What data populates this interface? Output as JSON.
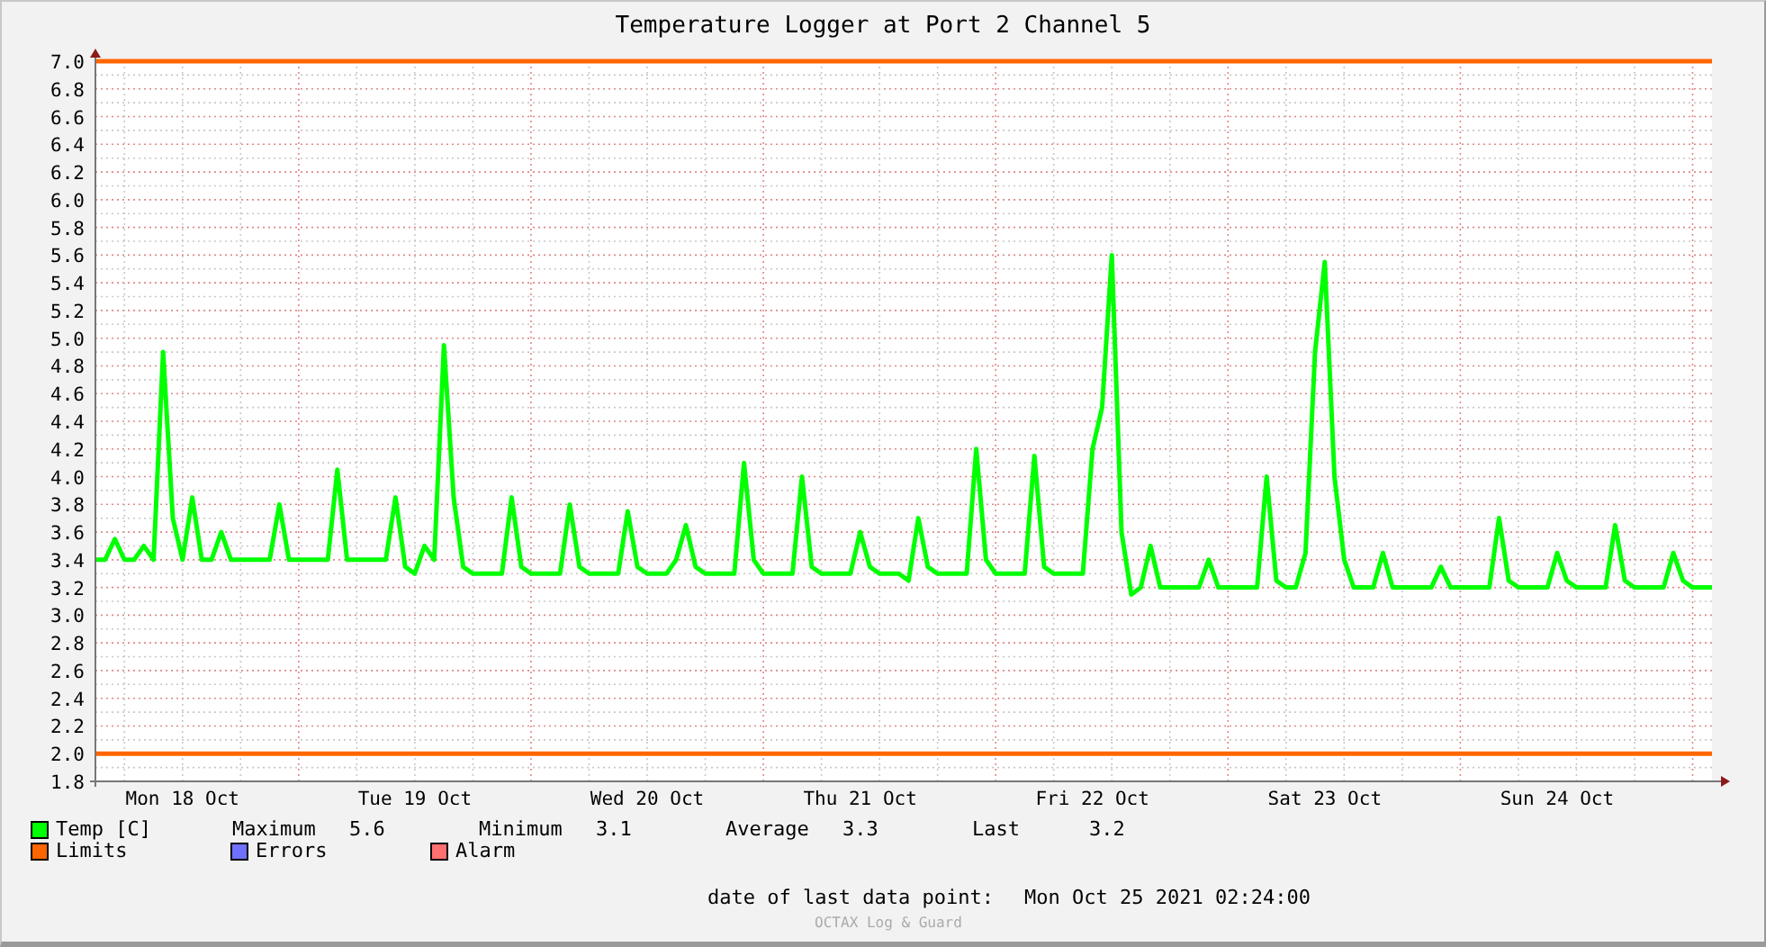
{
  "title": "Temperature Logger at Port 2 Channel 5",
  "chart_data": {
    "type": "line",
    "categories": [
      null,
      null,
      null,
      null,
      null,
      null,
      null,
      null,
      null,
      "Mon 18 Oct",
      null,
      null,
      null,
      null,
      null,
      null,
      null,
      null,
      null,
      null,
      null,
      null,
      null,
      null,
      null,
      null,
      null,
      null,
      null,
      null,
      null,
      null,
      null,
      "Tue 19 Oct",
      null,
      null,
      null,
      null,
      null,
      null,
      null,
      null,
      null,
      null,
      null,
      null,
      null,
      null,
      null,
      null,
      null,
      null,
      null,
      null,
      null,
      null,
      null,
      "Wed 20 Oct",
      null,
      null,
      null,
      null,
      null,
      null,
      null,
      null,
      null,
      null,
      null,
      null,
      null,
      null,
      null,
      null,
      null,
      null,
      null,
      null,
      null,
      "Thu 21 Oct",
      null,
      null,
      null,
      null,
      null,
      null,
      null,
      null,
      null,
      null,
      null,
      null,
      null,
      null,
      null,
      null,
      null,
      null,
      null,
      null,
      null,
      null,
      null,
      "Fri 22 Oct",
      null,
      null,
      null,
      null,
      null,
      null,
      null,
      null,
      null,
      null,
      null,
      null,
      null,
      null,
      null,
      null,
      null,
      null,
      null,
      null,
      null,
      null,
      null,
      "Sat 23 Oct",
      null,
      null,
      null,
      null,
      null,
      null,
      null,
      null,
      null,
      null,
      null,
      null,
      null,
      null,
      null,
      null,
      null,
      null,
      null,
      null,
      null,
      null,
      null,
      "Sun 24 Oct",
      null,
      null,
      null,
      null,
      null,
      null,
      null,
      null,
      null,
      null,
      null,
      null,
      null,
      null,
      null,
      null
    ],
    "series": [
      {
        "name": "Temp [C]",
        "color": "#00ff00",
        "values": [
          3.4,
          3.4,
          3.55,
          3.4,
          3.4,
          3.5,
          3.4,
          4.9,
          3.7,
          3.4,
          3.85,
          3.4,
          3.4,
          3.6,
          3.4,
          3.4,
          3.4,
          3.4,
          3.4,
          3.8,
          3.4,
          3.4,
          3.4,
          3.4,
          3.4,
          4.05,
          3.4,
          3.4,
          3.4,
          3.4,
          3.4,
          3.85,
          3.35,
          3.3,
          3.5,
          3.4,
          4.95,
          3.85,
          3.35,
          3.3,
          3.3,
          3.3,
          3.3,
          3.85,
          3.35,
          3.3,
          3.3,
          3.3,
          3.3,
          3.8,
          3.35,
          3.3,
          3.3,
          3.3,
          3.3,
          3.75,
          3.35,
          3.3,
          3.3,
          3.3,
          3.4,
          3.65,
          3.35,
          3.3,
          3.3,
          3.3,
          3.3,
          4.1,
          3.4,
          3.3,
          3.3,
          3.3,
          3.3,
          4.0,
          3.35,
          3.3,
          3.3,
          3.3,
          3.3,
          3.6,
          3.35,
          3.3,
          3.3,
          3.3,
          3.25,
          3.7,
          3.35,
          3.3,
          3.3,
          3.3,
          3.3,
          4.2,
          3.4,
          3.3,
          3.3,
          3.3,
          3.3,
          4.15,
          3.35,
          3.3,
          3.3,
          3.3,
          3.3,
          4.2,
          4.5,
          5.6,
          3.6,
          3.15,
          3.2,
          3.5,
          3.2,
          3.2,
          3.2,
          3.2,
          3.2,
          3.4,
          3.2,
          3.2,
          3.2,
          3.2,
          3.2,
          4.0,
          3.25,
          3.2,
          3.2,
          3.45,
          4.9,
          5.55,
          4.0,
          3.4,
          3.2,
          3.2,
          3.2,
          3.45,
          3.2,
          3.2,
          3.2,
          3.2,
          3.2,
          3.35,
          3.2,
          3.2,
          3.2,
          3.2,
          3.2,
          3.7,
          3.25,
          3.2,
          3.2,
          3.2,
          3.2,
          3.45,
          3.25,
          3.2,
          3.2,
          3.2,
          3.2,
          3.65,
          3.25,
          3.2,
          3.2,
          3.2,
          3.2,
          3.45,
          3.25,
          3.2,
          3.2,
          3.2
        ]
      }
    ],
    "ylim": [
      1.8,
      7.0
    ],
    "yticks": [
      {
        "value": 7.0,
        "label": "7.0"
      },
      {
        "value": 6.8,
        "label": "6.8"
      },
      {
        "value": 6.6,
        "label": "6.6"
      },
      {
        "value": 6.4,
        "label": "6.4"
      },
      {
        "value": 6.2,
        "label": "6.2"
      },
      {
        "value": 6.0,
        "label": "6.0"
      },
      {
        "value": 5.8,
        "label": "5.8"
      },
      {
        "value": 5.6,
        "label": "5.6"
      },
      {
        "value": 5.4,
        "label": "5.4"
      },
      {
        "value": 5.2,
        "label": "5.2"
      },
      {
        "value": 5.0,
        "label": "5.0"
      },
      {
        "value": 4.8,
        "label": "4.8"
      },
      {
        "value": 4.6,
        "label": "4.6"
      },
      {
        "value": 4.4,
        "label": "4.4"
      },
      {
        "value": 4.2,
        "label": "4.2"
      },
      {
        "value": 4.0,
        "label": "4.0"
      },
      {
        "value": 3.8,
        "label": "3.8"
      },
      {
        "value": 3.6,
        "label": "3.6"
      },
      {
        "value": 3.4,
        "label": "3.4"
      },
      {
        "value": 3.2,
        "label": "3.2"
      },
      {
        "value": 3.0,
        "label": "3.0"
      },
      {
        "value": 2.8,
        "label": "2.8"
      },
      {
        "value": 2.6,
        "label": "2.6"
      },
      {
        "value": 2.4,
        "label": "2.4"
      },
      {
        "value": 2.2,
        "label": "2.2"
      },
      {
        "value": 2.0,
        "label": "2.0"
      },
      {
        "value": 1.8,
        "label": "1.8"
      }
    ],
    "grid": true,
    "ref_lines": [
      {
        "axis": "y",
        "value": 7.0,
        "color": "#ff6600"
      },
      {
        "axis": "y",
        "value": 2.0,
        "color": "#ff6600"
      }
    ]
  },
  "legend": [
    {
      "label": "Limits",
      "color": "#ff6600"
    },
    {
      "label": "Errors",
      "color": "#7070ff"
    },
    {
      "label": "Alarm",
      "color": "#ff7070"
    }
  ],
  "statistics": [
    {
      "label": "Maximum",
      "value": "5.6"
    },
    {
      "label": "Minimum",
      "value": "3.1"
    },
    {
      "label": "Average",
      "value": "3.3"
    },
    {
      "label": "Last",
      "value": "3.2"
    }
  ],
  "last_data_point": {
    "label": "date of last data point:",
    "value": "Mon Oct 25 2021 02:24:00"
  },
  "credit": "OCTAX Log & Guard"
}
